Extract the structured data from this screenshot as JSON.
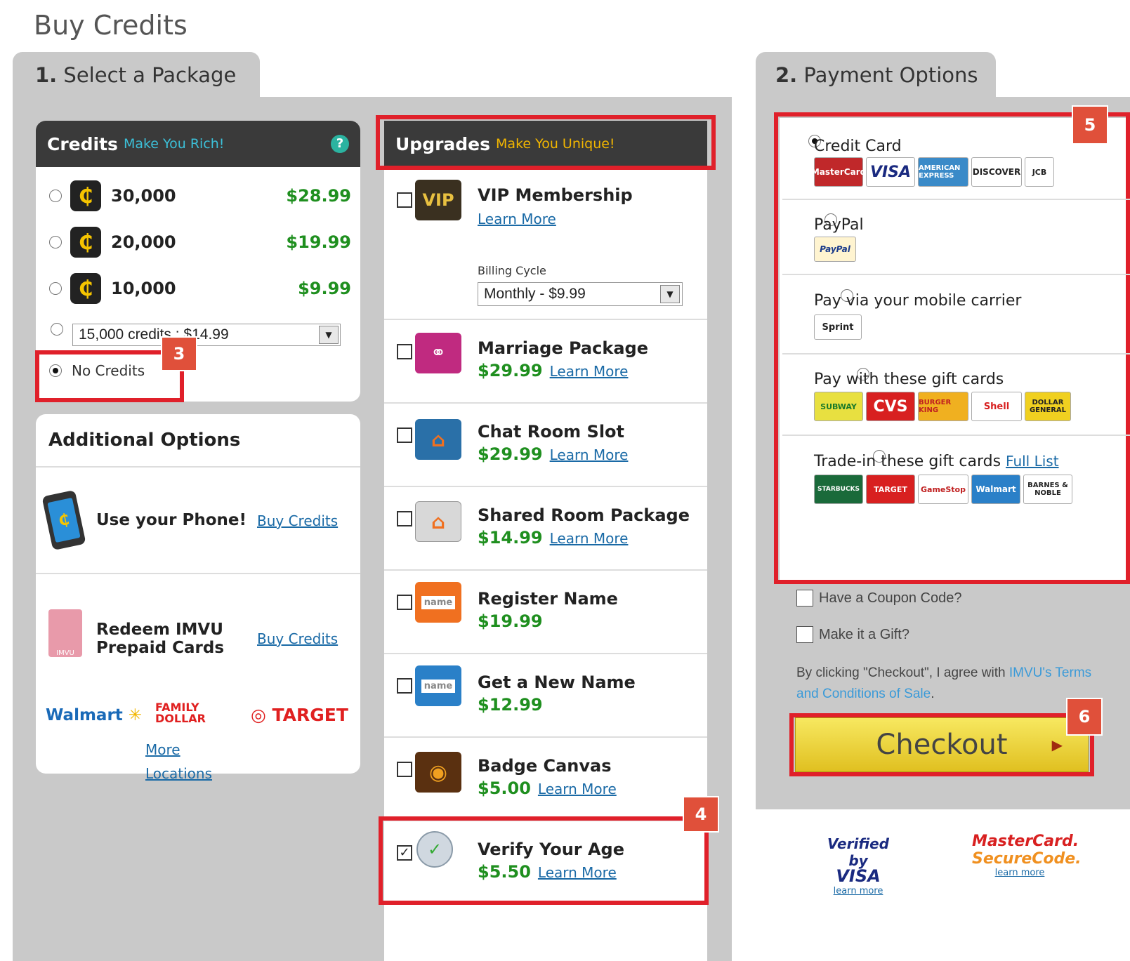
{
  "page_title": "Buy Credits",
  "step1": {
    "num": "1.",
    "label": "Select a Package"
  },
  "step2": {
    "num": "2.",
    "label": "Payment Options"
  },
  "credits": {
    "title": "Credits",
    "subtitle": "Make You Rich!",
    "options": [
      {
        "amount": "30,000",
        "price": "$28.99"
      },
      {
        "amount": "20,000",
        "price": "$19.99"
      },
      {
        "amount": "10,000",
        "price": "$9.99"
      }
    ],
    "dropdown_value": "15,000 credits : $14.99",
    "no_credits": "No Credits"
  },
  "additional": {
    "title": "Additional Options",
    "phone_label": "Use your Phone!",
    "phone_link": "Buy Credits",
    "prepaid_label_1": "Redeem IMVU",
    "prepaid_label_2": "Prepaid Cards",
    "prepaid_link": "Buy Credits",
    "stores": [
      "Walmart",
      "FAMILY DOLLAR",
      "TARGET"
    ],
    "more_1": "More",
    "more_2": "Locations"
  },
  "upgrades": {
    "title": "Upgrades",
    "subtitle": "Make You Unique!",
    "learn_more": "Learn More",
    "vip": {
      "name": "VIP Membership",
      "billing_label": "Billing Cycle",
      "billing_value": "Monthly - $9.99"
    },
    "items": [
      {
        "name": "Marriage Package",
        "price": "$29.99",
        "learn": "Learn More"
      },
      {
        "name": "Chat Room Slot",
        "price": "$29.99",
        "learn": "Learn More"
      },
      {
        "name": "Shared Room Package",
        "price": "$14.99",
        "learn": "Learn More"
      },
      {
        "name": "Register Name",
        "price": "$19.99",
        "learn": ""
      },
      {
        "name": "Get a New Name",
        "price": "$12.99",
        "learn": ""
      },
      {
        "name": "Badge Canvas",
        "price": "$5.00",
        "learn": "Learn More"
      },
      {
        "name": "Verify Your Age",
        "price": "$5.50",
        "learn": "Learn More"
      }
    ]
  },
  "payment": {
    "credit_card": "Credit Card",
    "paypal": "PayPal",
    "mobile": "Pay via your mobile carrier",
    "gift": "Pay with these gift cards",
    "trade": "Trade-in these gift cards",
    "full_list": "Full List",
    "card_logos": [
      "MasterCard",
      "VISA",
      "AMERICAN EXPRESS",
      "DISCOVER",
      "JCB"
    ],
    "paypal_logo": "PayPal",
    "sprint_logo": "Sprint",
    "gift_logos": [
      "SUBWAY",
      "CVS",
      "BURGER KING",
      "Shell",
      "DOLLAR GENERAL"
    ],
    "trade_logos": [
      "STARBUCKS",
      "TARGET",
      "GameStop",
      "Walmart",
      "BARNES & NOBLE"
    ]
  },
  "coupon": "Have a Coupon Code?",
  "gift_opt": "Make it a Gift?",
  "terms_pre": "By clicking \"Checkout\", I agree with",
  "terms_brand": "IMVU's",
  "terms_link": "Terms and Conditions of Sale",
  "terms_post": ".",
  "checkout": "Checkout",
  "verified_visa": {
    "line1": "Verified by",
    "line2": "VISA",
    "link": "learn more"
  },
  "mc_secure": {
    "line1": "MasterCard.",
    "line2": "SecureCode.",
    "link": "learn more"
  },
  "badges": [
    "3",
    "4",
    "5",
    "6"
  ],
  "colors": {
    "accent_red": "#e0202a",
    "price_green": "#1f8f1f",
    "link_blue": "#1a6aa6",
    "badge": "#e0503a"
  }
}
